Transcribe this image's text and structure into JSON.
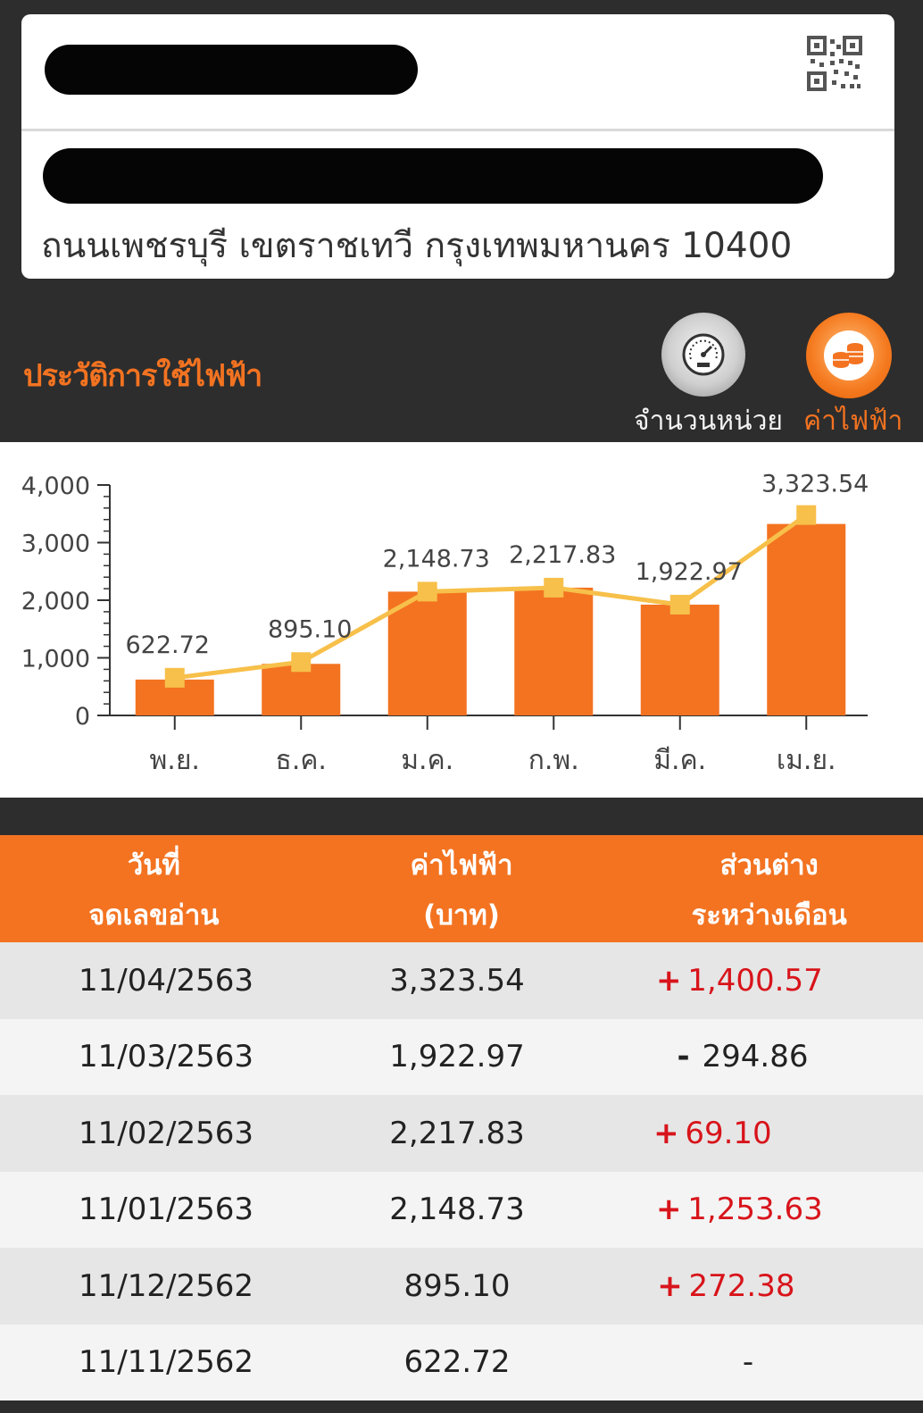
{
  "account": {
    "address_line": "ถนนเพชรบุรี เขตราชเทวี กรุงเทพมหานคร 10400",
    "qr_icon": "qr-code-icon"
  },
  "history": {
    "title": "ประวัติการใช้ไฟฟ้า",
    "toggle_units_label": "จำนวนหน่วย",
    "toggle_cost_label": "ค่าไฟฟ้า",
    "units_icon": "gauge-icon",
    "cost_icon": "coins-icon",
    "accent_color": "#f37321",
    "line_color": "#f7c04a"
  },
  "chart_data": {
    "type": "bar",
    "categories": [
      "พ.ย.",
      "ธ.ค.",
      "ม.ค.",
      "ก.พ.",
      "มี.ค.",
      "เม.ย."
    ],
    "values": [
      622.72,
      895.1,
      2148.73,
      2217.83,
      1922.97,
      3323.54
    ],
    "value_labels": [
      "622.72",
      "895.10",
      "2,148.73",
      "2,217.83",
      "1,922.97",
      "3,323.54"
    ],
    "overlay": "line",
    "ylim": [
      0,
      4000
    ],
    "yticks": [
      0,
      1000,
      2000,
      3000,
      4000
    ],
    "ytick_labels": [
      "0",
      "1,000",
      "2,000",
      "3,000",
      "4,000"
    ],
    "title": "",
    "xlabel": "",
    "ylabel": "",
    "grid": false
  },
  "table": {
    "headers": [
      {
        "line1": "วันที่",
        "line2": "จดเลขอ่าน"
      },
      {
        "line1": "ค่าไฟฟ้า",
        "line2": "(บาท)"
      },
      {
        "line1": "ส่วนต่าง",
        "line2": "ระหว่างเดือน"
      }
    ],
    "rows": [
      {
        "date": "11/04/2563",
        "amount": "3,323.54",
        "sign": "+",
        "diff": "1,400.57"
      },
      {
        "date": "11/03/2563",
        "amount": "1,922.97",
        "sign": "-",
        "diff": "294.86"
      },
      {
        "date": "11/02/2563",
        "amount": "2,217.83",
        "sign": "+",
        "diff": "69.10"
      },
      {
        "date": "11/01/2563",
        "amount": "2,148.73",
        "sign": "+",
        "diff": "1,253.63"
      },
      {
        "date": "11/12/2562",
        "amount": "895.10",
        "sign": "+",
        "diff": "272.38"
      },
      {
        "date": "11/11/2562",
        "amount": "622.72",
        "sign": "",
        "diff": "-"
      }
    ]
  }
}
